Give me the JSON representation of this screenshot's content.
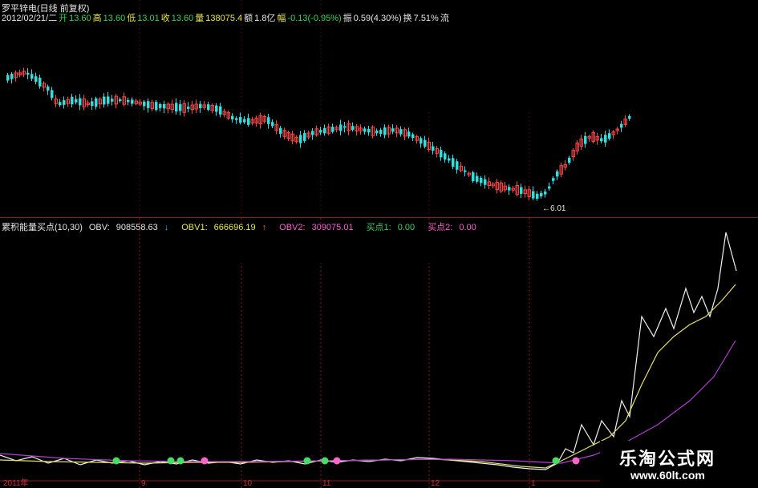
{
  "header": {
    "title": "罗平锌电(日线 前复权)",
    "date": "2012/02/21/二",
    "open_label": "开",
    "open": "13.60",
    "high_label": "高",
    "high": "13.60",
    "low_label": "低",
    "low": "13.01",
    "close_label": "收",
    "close": "13.60",
    "vol_label": "量",
    "vol": "138075.4",
    "amount_label": "额",
    "amount": "1.8亿",
    "change_label": "幅",
    "change": "-0.13(-0.95%)",
    "amp_label": "振",
    "amp": "0.59(4.30%)",
    "turn_label": "换",
    "turn": "7.51%",
    "flow_label": "流"
  },
  "price_panel": {
    "low_marker": "←6.01"
  },
  "indicator": {
    "name": "累积能量买点(10,30)",
    "obv_label": "OBV:",
    "obv": "908558.63",
    "obv1_label": "OBV1:",
    "obv1": "666696.19",
    "obv2_label": "OBV2:",
    "obv2": "309075.01",
    "buy1_label": "买点1:",
    "buy1": "0.00",
    "buy2_label": "买点2:",
    "buy2": "0.00"
  },
  "x_axis": {
    "labels": [
      "2011年",
      "9",
      "10",
      "11",
      "12",
      "1"
    ]
  },
  "watermark": {
    "line1": "乐淘公式网",
    "line2": "www.60lt.com"
  },
  "colors": {
    "up": "#ff4444",
    "down": "#33dddd",
    "obv": "#f0f0f0",
    "obv1": "#e8e070",
    "obv2": "#b040d0",
    "buy1": "#44dd66",
    "buy2": "#ff66cc",
    "grid": "#8a1a1a"
  }
}
